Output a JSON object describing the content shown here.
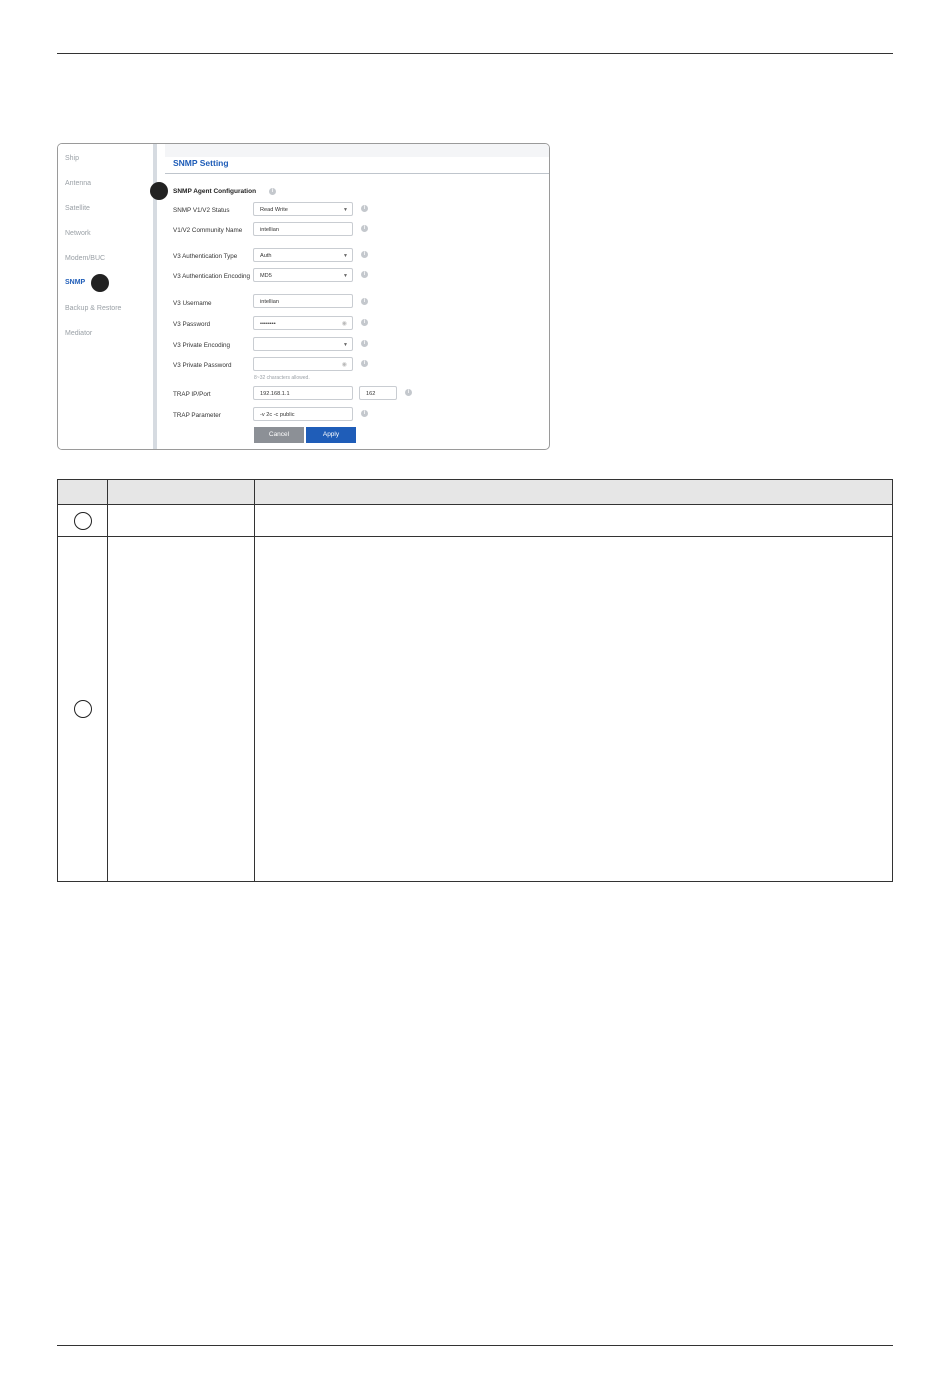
{
  "sidebar": {
    "items": [
      {
        "label": "Ship"
      },
      {
        "label": "Antenna"
      },
      {
        "label": "Satellite"
      },
      {
        "label": "Network"
      },
      {
        "label": "Modem/BUC"
      },
      {
        "label": "SNMP"
      },
      {
        "label": "Backup & Restore"
      },
      {
        "label": "Mediator"
      }
    ],
    "active": "SNMP"
  },
  "panel": {
    "title": "SNMP Setting",
    "section": "SNMP Agent Configuration",
    "fields": [
      {
        "label": "SNMP V1/V2 Status",
        "value": "Read Write",
        "type": "select"
      },
      {
        "label": "V1/V2 Community Name",
        "value": "intellian",
        "type": "text"
      },
      {
        "label": "V3 Authentication Type",
        "value": "Auth",
        "type": "select"
      },
      {
        "label": "V3 Authentication Encoding",
        "value": "MD5",
        "type": "select"
      },
      {
        "label": "V3 Username",
        "value": "intellian",
        "type": "text"
      },
      {
        "label": "V3 Password",
        "value": "••••••••",
        "type": "password"
      },
      {
        "label": "V3 Private Encoding",
        "value": "",
        "type": "select"
      },
      {
        "label": "V3 Private Password",
        "value": "",
        "type": "password"
      },
      {
        "label": "TRAP IP/Port",
        "value": "192.168.1.1",
        "type": "text"
      },
      {
        "label": "TRAP Parameter",
        "value": "-v 2c -c public",
        "type": "text"
      }
    ],
    "trap_port": "162",
    "password_hint": "8~32 characters allowed.",
    "buttons": {
      "cancel": "Cancel",
      "apply": "Apply"
    }
  }
}
